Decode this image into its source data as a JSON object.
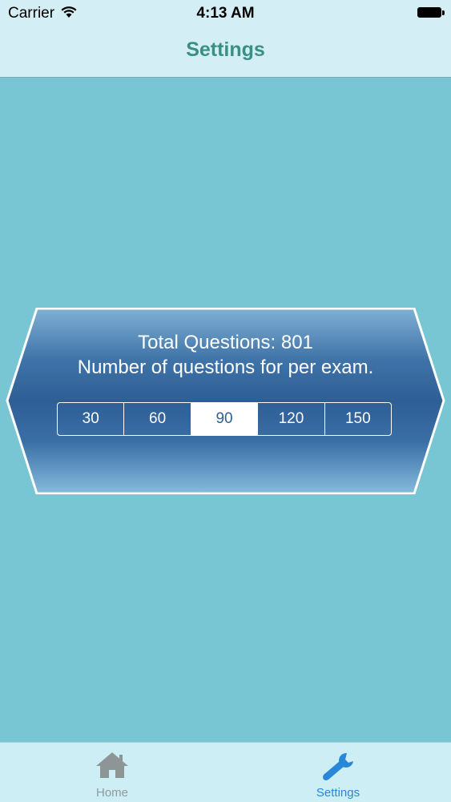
{
  "status": {
    "carrier": "Carrier",
    "time": "4:13 AM"
  },
  "nav": {
    "title": "Settings"
  },
  "panel": {
    "total_questions": "Total Questions: 801",
    "subtitle": "Number of questions for per exam.",
    "options": [
      "30",
      "60",
      "90",
      "120",
      "150"
    ],
    "selected": "90"
  },
  "tabs": [
    {
      "label": "Home",
      "icon": "home-icon",
      "active": false
    },
    {
      "label": "Settings",
      "icon": "wrench-icon",
      "active": true
    }
  ],
  "colors": {
    "background": "#78c6d3",
    "nav_title": "#3a8f85",
    "panel_dark": "#2f5f95",
    "tab_active": "#2a86d8",
    "tab_inactive": "#8d9b9e"
  }
}
